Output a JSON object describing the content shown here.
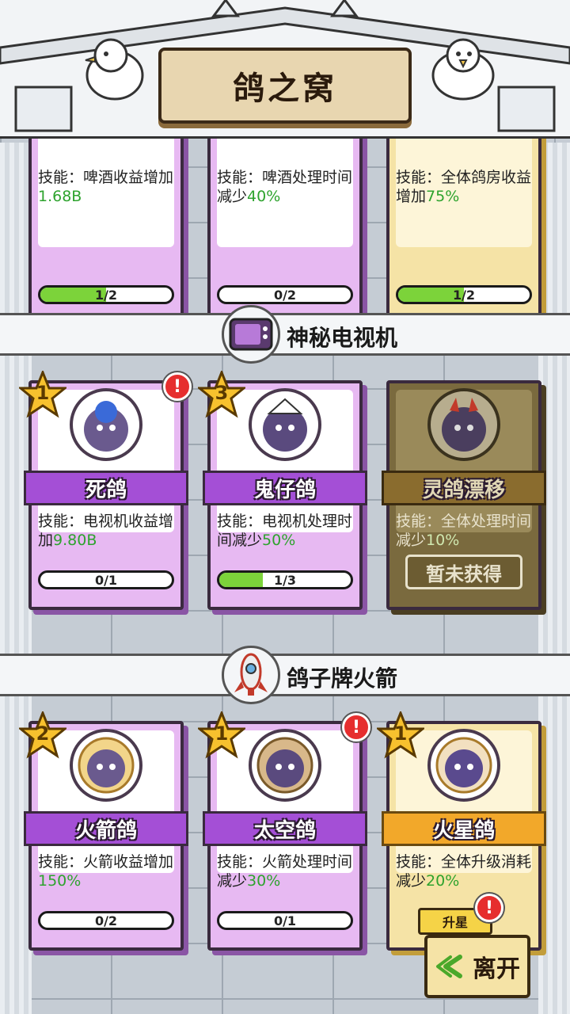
{
  "header": {
    "title": "鸽之窝"
  },
  "sections": [
    {
      "label": "神秘电视机"
    },
    {
      "label": "鸽子牌火箭"
    }
  ],
  "row0": [
    {
      "skill_prefix": "技能：啤酒收益增加",
      "skill_value": "1.68B",
      "progress": "1/2",
      "progress_frac": 0.5
    },
    {
      "skill_prefix": "技能：啤酒处理时间减少",
      "skill_value": "40%",
      "progress": "0/2",
      "progress_frac": 0
    },
    {
      "skill_prefix": "技能：全体鸽房收益增加",
      "skill_value": "75%",
      "progress": "1/2",
      "progress_frac": 0.5
    }
  ],
  "row1": [
    {
      "star": "1",
      "name": "死鸽",
      "skill_prefix": "技能：电视机收益增加",
      "skill_value": "9.80B",
      "progress": "0/1",
      "progress_frac": 0,
      "alert": "!"
    },
    {
      "star": "3",
      "name": "鬼仔鸽",
      "skill_prefix": "技能：电视机处理时间减少",
      "skill_value": "50%",
      "progress": "1/3",
      "progress_frac": 0.33
    },
    {
      "name": "灵鸽漂移",
      "skill_prefix": "技能：全体处理时间减少",
      "skill_value": "10%",
      "locked_label": "暂未获得"
    }
  ],
  "row2": [
    {
      "star": "2",
      "name": "火箭鸽",
      "skill_prefix": "技能：火箭收益增加",
      "skill_value": "150%",
      "progress": "0/2",
      "progress_frac": 0
    },
    {
      "star": "1",
      "name": "太空鸽",
      "skill_prefix": "技能：火箭处理时间减少",
      "skill_value": "30%",
      "progress": "0/1",
      "progress_frac": 0,
      "alert": "!"
    },
    {
      "star": "1",
      "name": "火星鸽",
      "skill_prefix": "技能：全体升级消耗减少",
      "skill_value": "20%",
      "upgrade_label": "升星",
      "alert": "!"
    }
  ],
  "leave_label": "离开",
  "colors": {
    "purple_card": "#e7b9f2",
    "gold_card": "#f5e3a6",
    "locked_card": "#7a6a3e",
    "progress_green": "#7cd33a",
    "alert_red": "#e62e2e"
  },
  "icons": [
    "tv-icon",
    "rocket-icon",
    "star-icon",
    "alert-icon",
    "leave-arrow-icon"
  ]
}
